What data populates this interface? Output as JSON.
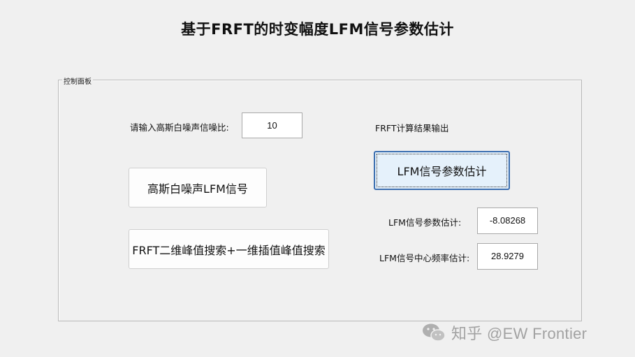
{
  "window": {
    "title": "基于FRFT的时变幅度LFM信号参数估计"
  },
  "panel": {
    "label": "控制面板",
    "snr_label": "请输入高斯白噪声信噪比:",
    "snr_value": "10",
    "gen_button": "高斯白噪声LFM信号",
    "search_button": "FRFT二维峰值搜索+一维插值峰值搜索",
    "output_label": "FRFT计算结果输出",
    "estimate_button": "LFM信号参数估计",
    "param_label": "LFM信号参数估计:",
    "param_value": "-8.08268",
    "center_freq_label": "LFM信号中心频率估计:",
    "center_freq_value": "28.9279"
  },
  "watermark": {
    "text": "知乎 @EW Frontier",
    "icon": "wechat-icon"
  }
}
